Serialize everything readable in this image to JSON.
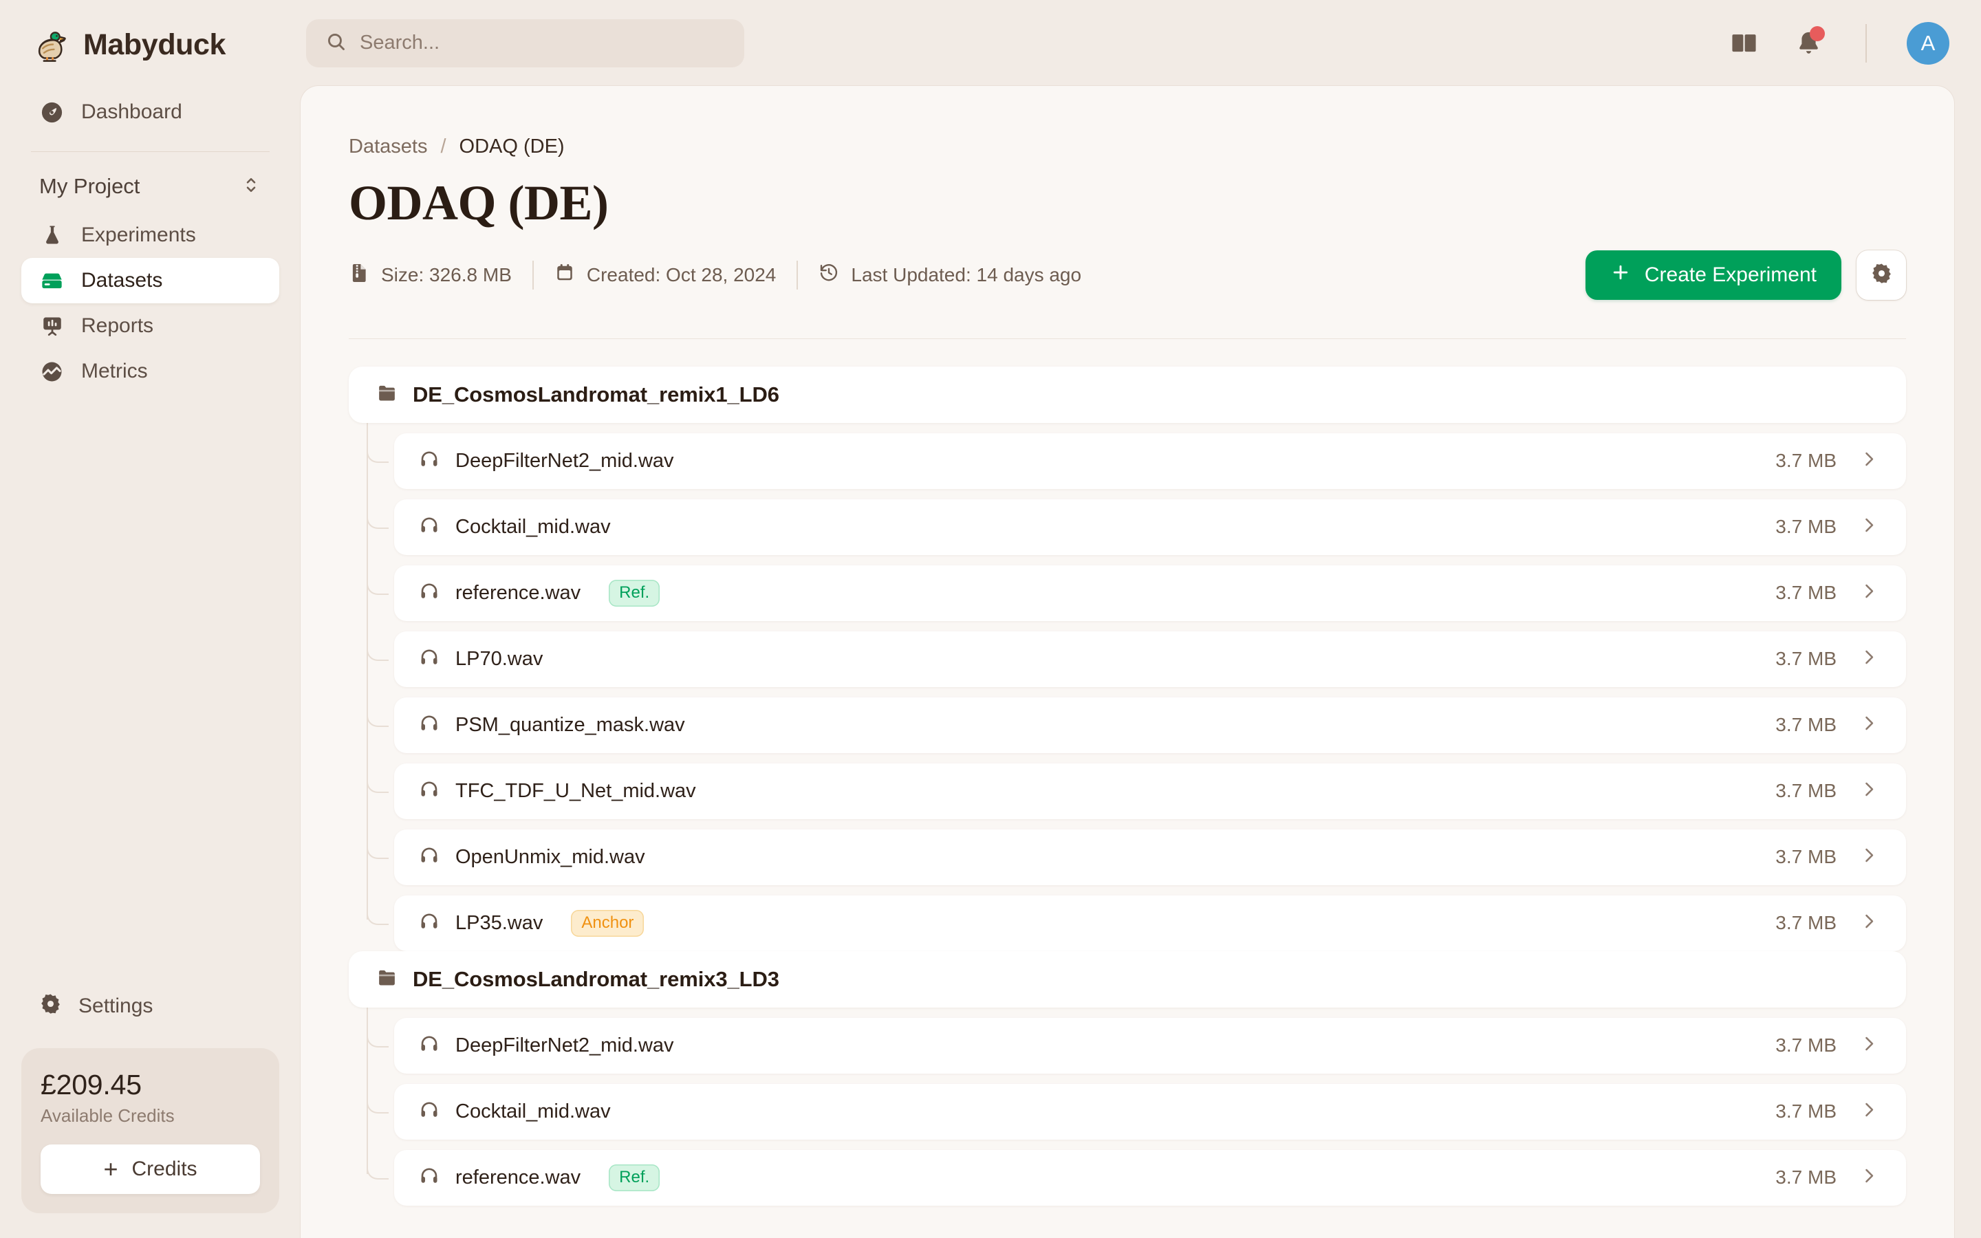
{
  "brand": {
    "name": "Mabyduck",
    "logo_icon": "duck-logo-icon"
  },
  "search": {
    "placeholder": "Search...",
    "value": "",
    "icon": "search-icon"
  },
  "topbar": {
    "docs_icon": "book-icon",
    "notifications_icon": "bell-icon",
    "has_notification": true,
    "avatar_initial": "A"
  },
  "sidebar": {
    "dashboard": {
      "label": "Dashboard",
      "icon": "speedometer-icon"
    },
    "project": {
      "label": "My Project",
      "icon": "chevron-up-down-icon"
    },
    "items": [
      {
        "label": "Experiments",
        "icon": "flask-icon",
        "active": false
      },
      {
        "label": "Datasets",
        "icon": "drive-icon",
        "active": true
      },
      {
        "label": "Reports",
        "icon": "presentation-icon",
        "active": false
      },
      {
        "label": "Metrics",
        "icon": "chart-circle-icon",
        "active": false
      }
    ],
    "settings": {
      "label": "Settings",
      "icon": "gear-icon"
    },
    "credits": {
      "amount": "£209.45",
      "label": "Available Credits",
      "button_label": "Credits",
      "button_icon": "plus-icon"
    }
  },
  "breadcrumb": {
    "root": "Datasets",
    "separator": "/",
    "current": "ODAQ (DE)"
  },
  "page": {
    "title": "ODAQ (DE)",
    "meta": [
      {
        "icon": "file-archive-icon",
        "text": "Size: 326.8 MB"
      },
      {
        "icon": "calendar-icon",
        "text": "Created: Oct 28, 2024"
      },
      {
        "icon": "clock-history-icon",
        "text": "Last Updated: 14 days ago"
      }
    ],
    "create_button": {
      "label": "Create Experiment",
      "icon": "plus-icon"
    },
    "settings_button": {
      "icon": "gear-icon"
    }
  },
  "colors": {
    "accent_green": "#00a05a",
    "badge_ref_text": "#00a05a",
    "badge_anchor_text": "#f09111",
    "avatar_blue": "#4a9cd4",
    "notification_red": "#e75c5c",
    "sidebar_bg": "#f2ebe5",
    "panel_bg": "#faf7f4"
  },
  "groups": [
    {
      "name": "DE_CosmosLandromat_remix1_LD6",
      "icon": "folder-icon",
      "files": [
        {
          "name": "DeepFilterNet2_mid.wav",
          "size": "3.7 MB",
          "badge": null
        },
        {
          "name": "Cocktail_mid.wav",
          "size": "3.7 MB",
          "badge": null
        },
        {
          "name": "reference.wav",
          "size": "3.7 MB",
          "badge": "Ref."
        },
        {
          "name": "LP70.wav",
          "size": "3.7 MB",
          "badge": null
        },
        {
          "name": "PSM_quantize_mask.wav",
          "size": "3.7 MB",
          "badge": null
        },
        {
          "name": "TFC_TDF_U_Net_mid.wav",
          "size": "3.7 MB",
          "badge": null
        },
        {
          "name": "OpenUnmix_mid.wav",
          "size": "3.7 MB",
          "badge": null
        },
        {
          "name": "LP35.wav",
          "size": "3.7 MB",
          "badge": "Anchor"
        }
      ]
    },
    {
      "name": "DE_CosmosLandromat_remix3_LD3",
      "icon": "folder-icon",
      "files": [
        {
          "name": "DeepFilterNet2_mid.wav",
          "size": "3.7 MB",
          "badge": null
        },
        {
          "name": "Cocktail_mid.wav",
          "size": "3.7 MB",
          "badge": null
        },
        {
          "name": "reference.wav",
          "size": "3.7 MB",
          "badge": "Ref."
        }
      ]
    }
  ]
}
